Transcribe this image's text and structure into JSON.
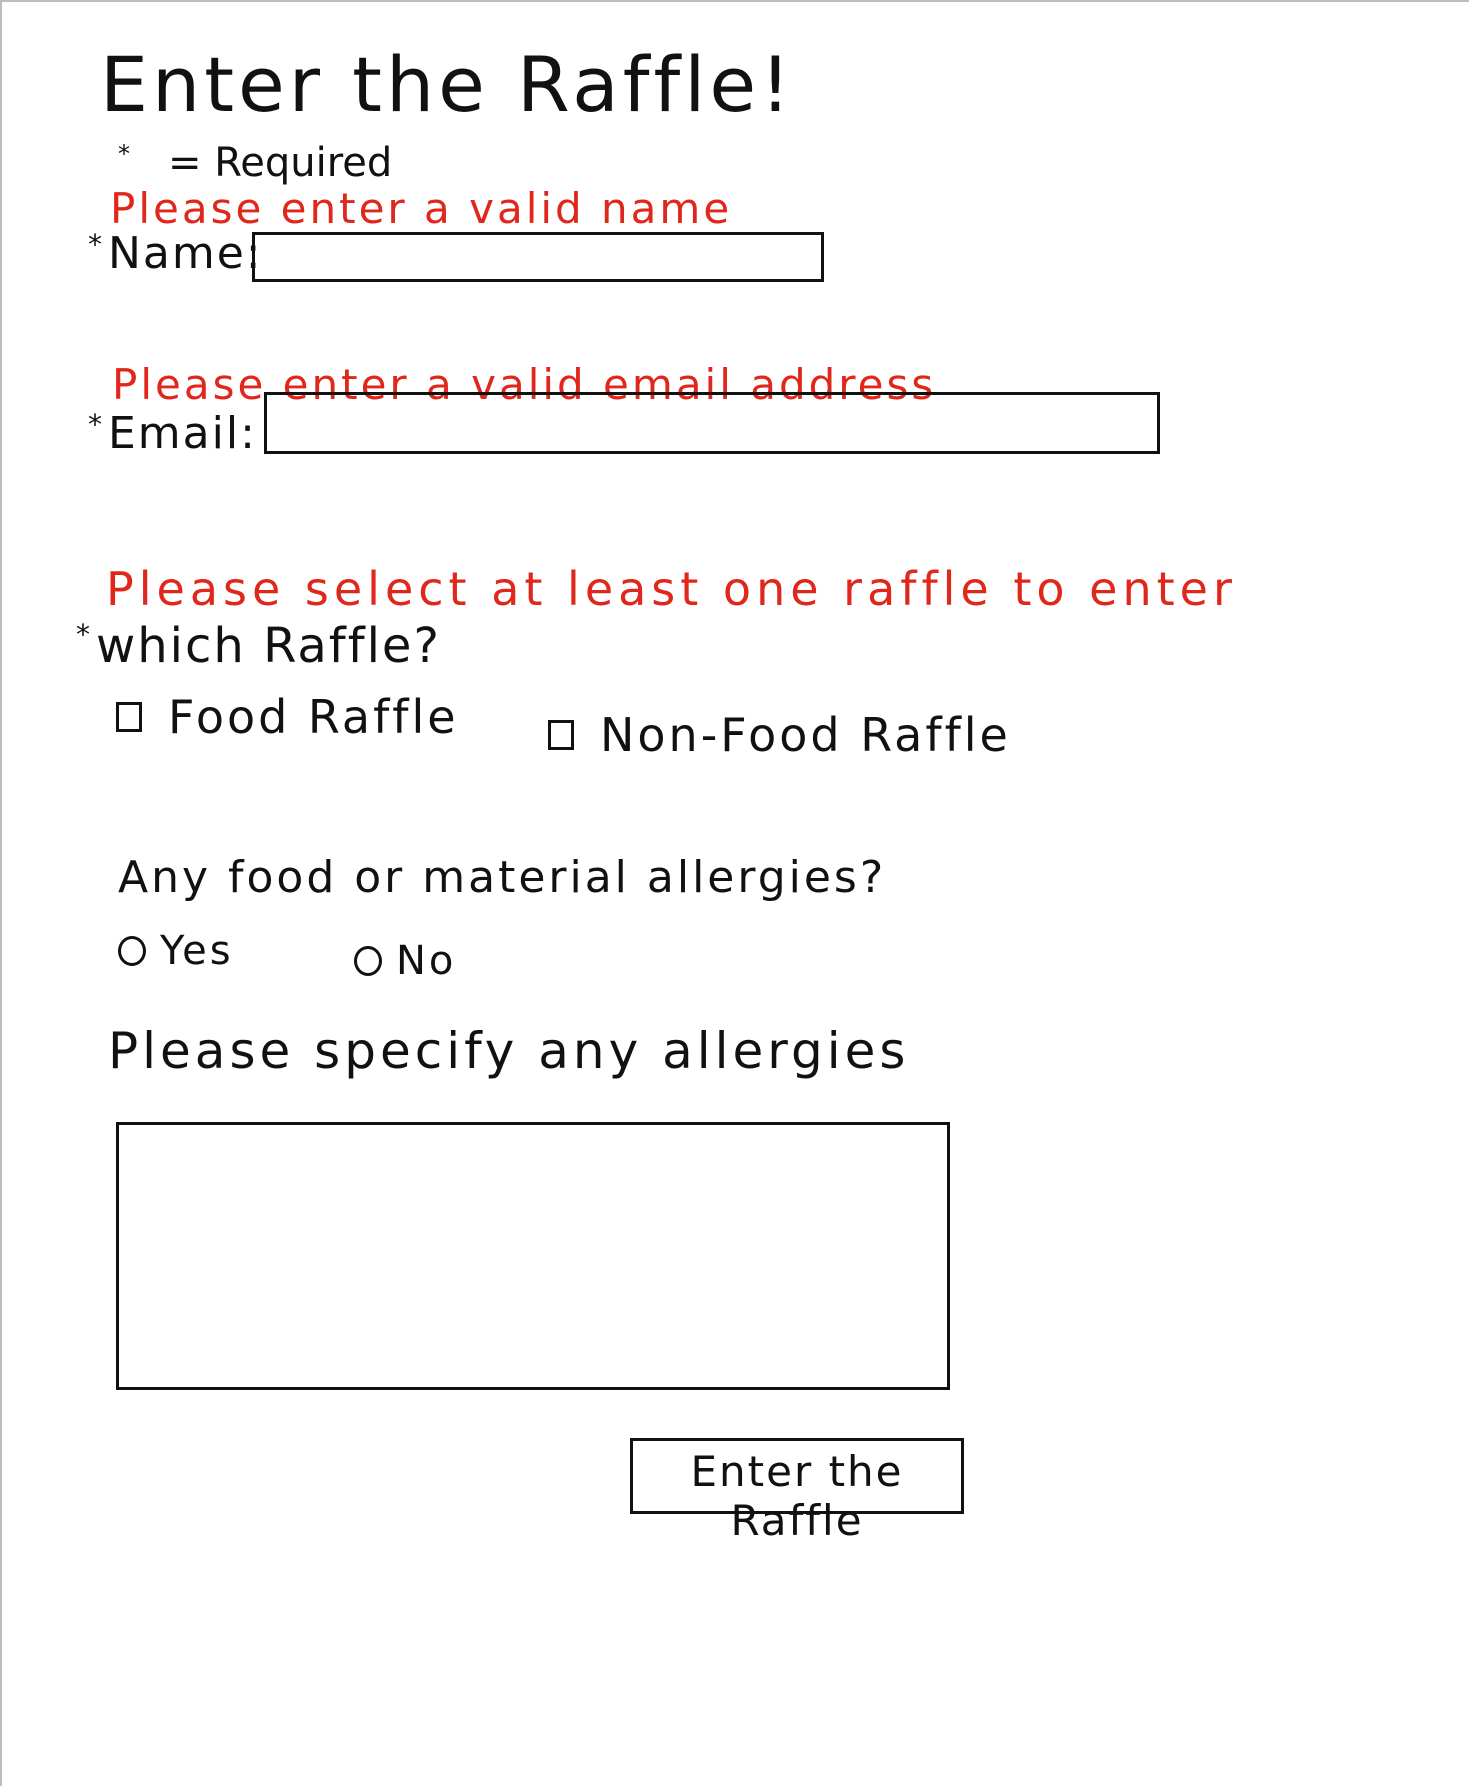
{
  "form": {
    "title": "Enter the Raffle!",
    "required_legend": {
      "star": "*",
      "text": "= Required"
    },
    "required_star": "*",
    "name_error": "Please enter a valid name",
    "name_label": "Name:",
    "name_value": "",
    "email_error": "Please enter a valid email address",
    "email_label": "Email:",
    "email_value": "",
    "raffle_error": "Please select at least one raffle to enter",
    "raffle_question": "which Raffle?",
    "raffle_options": [
      {
        "label": "Food Raffle",
        "checked": false
      },
      {
        "label": "Non-Food Raffle",
        "checked": false
      }
    ],
    "allergy_question": "Any food or material allergies?",
    "allergy_options": [
      {
        "label": "Yes",
        "selected": false
      },
      {
        "label": "No",
        "selected": false
      }
    ],
    "allergy_specify_label": "Please specify any allergies",
    "allergy_specify_value": "",
    "submit_label": "Enter the Raffle"
  },
  "colors": {
    "error": "#e0271b",
    "ink": "#111111",
    "background": "#ffffff"
  }
}
